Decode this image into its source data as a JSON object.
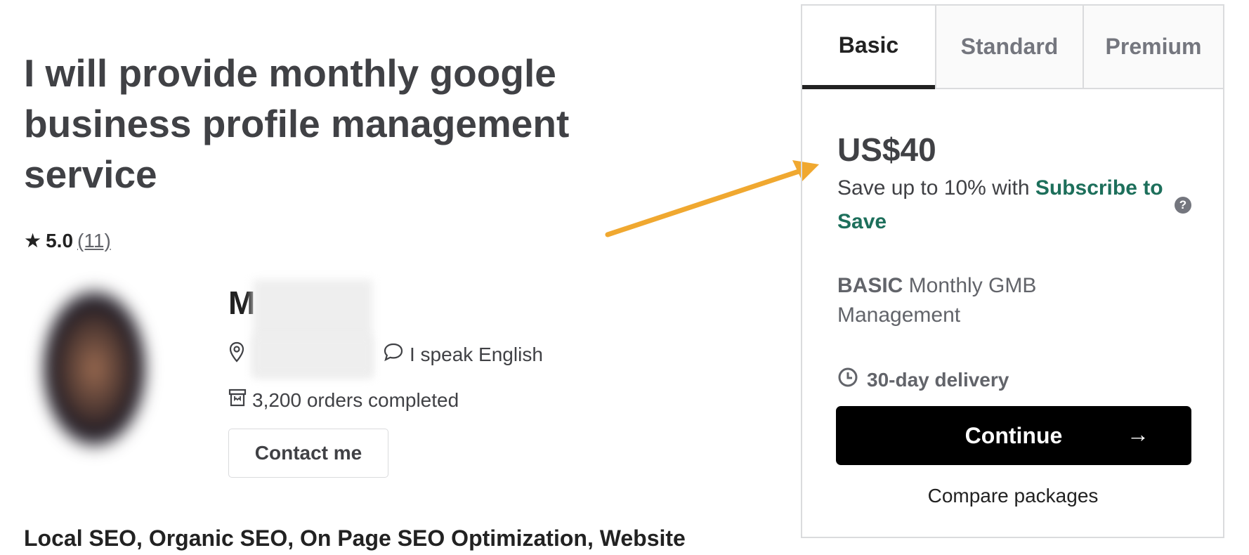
{
  "gig": {
    "title": "I will provide monthly google business profile management service",
    "rating": "5.0",
    "review_count": "(11)",
    "skills": "Local SEO, Organic SEO, On Page SEO Optimization, Website"
  },
  "seller": {
    "name_initial": "M",
    "language": "I speak English",
    "orders": "3,200 orders completed",
    "contact_label": "Contact me"
  },
  "pricing": {
    "tabs": [
      {
        "label": "Basic"
      },
      {
        "label": "Standard"
      },
      {
        "label": "Premium"
      }
    ],
    "price": "US$40",
    "save_text": "Save up to 10% with ",
    "save_link": "Subscribe to Save",
    "help_icon": "?",
    "package_name": "BASIC",
    "package_desc": " Monthly GMB Management",
    "delivery": "30-day delivery",
    "continue_label": "Continue",
    "continue_arrow": "→",
    "compare_label": "Compare packages"
  },
  "colors": {
    "accent": "#1d6f5b",
    "annotation_arrow": "#f0a830"
  }
}
